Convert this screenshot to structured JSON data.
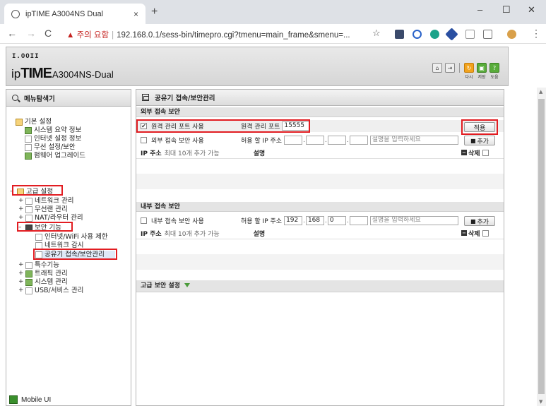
{
  "browser": {
    "tab_title": "ipTIME A3004NS Dual",
    "tab_close": "×",
    "new_tab": "+",
    "win_min": "–",
    "win_max": "☐",
    "win_close": "✕",
    "nav_back": "←",
    "nav_forward": "→",
    "nav_reload": "C",
    "security_warning": "▲ 주의 요함",
    "separator": "|",
    "url": "192.168.0.1/sess-bin/timepro.cgi?tmenu=main_frame&smenu=...",
    "star": "☆",
    "menu_dots": "⋮"
  },
  "header": {
    "logo_small": "I.OOII",
    "logo_ip": "ip",
    "logo_time": "TIME",
    "model": "A3004NS-Dual",
    "icon_home": "⌂",
    "icon_logout": "⇥",
    "icon_again_label": "다시",
    "icon_save_label": "저장",
    "icon_help_label": "도움",
    "icon_help": "?"
  },
  "left_menu": {
    "title": "메뉴탐색기",
    "items": {
      "basic": "기본 설정",
      "sys_summary": "시스템 요약 정보",
      "internet": "인터넷 설정 정보",
      "wireless_basic": "무선 설정/보안",
      "firmware": "펌웨어 업그레이드",
      "advanced": "고급 설정",
      "network": "네트워크 관리",
      "wireless": "무선랜 관리",
      "nat": "NAT/라우터 관리",
      "security": "보안 기능",
      "inet_limit": "인터넷/WiFi 사용 제한",
      "net_monitor": "네트워크 감시",
      "router_access": "공유기 접속/보안관리",
      "special": "특수기능",
      "traffic": "트래픽 관리",
      "system": "시스템 관리",
      "usb": "USB/서비스 관리"
    },
    "mobile_ui": "Mobile UI"
  },
  "main": {
    "title": "공유기 접속/보안관리",
    "external": {
      "heading": "외부 접속 보안",
      "remote_port_enable": "원격 관리 포트 사용",
      "remote_port_label": "원격 관리 포트",
      "remote_port_value": "15555",
      "apply_button": "적용",
      "ext_access_enable": "외부 접속 보안 사용",
      "allowed_ip_label": "허용 할 IP 주소",
      "ip1": "",
      "ip2": "",
      "ip3": "",
      "ip4": "",
      "desc_placeholder": "설명을 입력하세요",
      "add_button": "추가",
      "col_ip": "IP 주소",
      "col_ip_hint": "최대 10개 추가 가능",
      "col_desc": "설명",
      "col_delete": "삭제"
    },
    "internal": {
      "heading": "내부 접속 보안",
      "int_access_enable": "내부 접속 보안 사용",
      "allowed_ip_label": "허용 할 IP 주소",
      "ip1": "192",
      "ip2": "168",
      "ip3": "0",
      "ip4": "",
      "desc_placeholder": "설명을 입력하세요",
      "add_button": "추가",
      "col_ip": "IP 주소",
      "col_ip_hint": "최대 10개 추가 가능",
      "col_desc": "설명",
      "col_delete": "삭제"
    },
    "advanced": {
      "heading": "고급 보안 설정"
    }
  },
  "colors": {
    "highlight_box": "#e21d22",
    "section_bg": "#e4e4e4",
    "accent_green": "#4b9b3b"
  }
}
